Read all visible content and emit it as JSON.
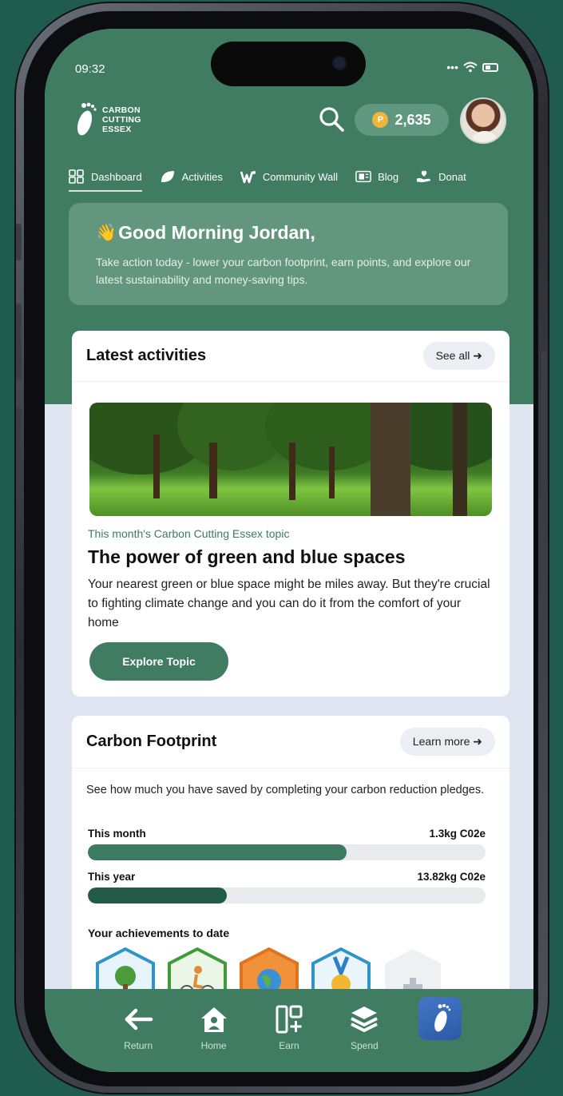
{
  "status_bar": {
    "time": "09:32"
  },
  "header": {
    "logo_lines": [
      "CARBON",
      "CUTTING",
      "ESSEX"
    ],
    "points": "2,635",
    "coin_letter": "P"
  },
  "topnav": [
    {
      "label": "Dashboard",
      "icon": "dashboard-grid-icon",
      "active": true
    },
    {
      "label": "Activities",
      "icon": "leaf-icon"
    },
    {
      "label": "Community Wall",
      "icon": "community-icon"
    },
    {
      "label": "Blog",
      "icon": "blog-icon"
    },
    {
      "label": "Donat",
      "icon": "donate-hand-icon"
    }
  ],
  "greeting": {
    "title": "Good Morning Jordan,",
    "emoji": "👋",
    "text": "Take action today - lower your carbon footprint, earn points, and explore our latest sustainability and money-saving tips."
  },
  "activities": {
    "title": "Latest activities",
    "see_all": "See all ➜",
    "topic_label": "This month's Carbon Cutting Essex topic",
    "topic_title": "The power of green and blue spaces",
    "topic_desc": "Your nearest green or blue space might be miles away. But they're crucial to fighting climate change and you can do it from the comfort of your home",
    "explore_btn": "Explore Topic"
  },
  "carbon": {
    "title": "Carbon Footprint",
    "learn_more": "Learn more ➜",
    "desc": "See how much you have saved by completing your carbon reduction pledges.",
    "month_label": "This month",
    "month_value": "1.3kg C02e",
    "month_progress": 0.65,
    "year_label": "This year",
    "year_value": "13.82kg C02e",
    "year_progress": 0.35,
    "achievements_label": "Your achievements to date"
  },
  "colors": {
    "brand_green": "#3f7c61",
    "bar_month": "#3d7b60",
    "bar_year": "#225c48"
  },
  "bottom_nav": [
    {
      "label": "Return",
      "icon": "arrow-left-icon"
    },
    {
      "label": "Home",
      "icon": "home-icon"
    },
    {
      "label": "Earn",
      "icon": "earn-grid-plus-icon"
    },
    {
      "label": "Spend",
      "icon": "layers-icon"
    },
    {
      "label": "",
      "icon": "footprint-icon",
      "active": true
    }
  ]
}
